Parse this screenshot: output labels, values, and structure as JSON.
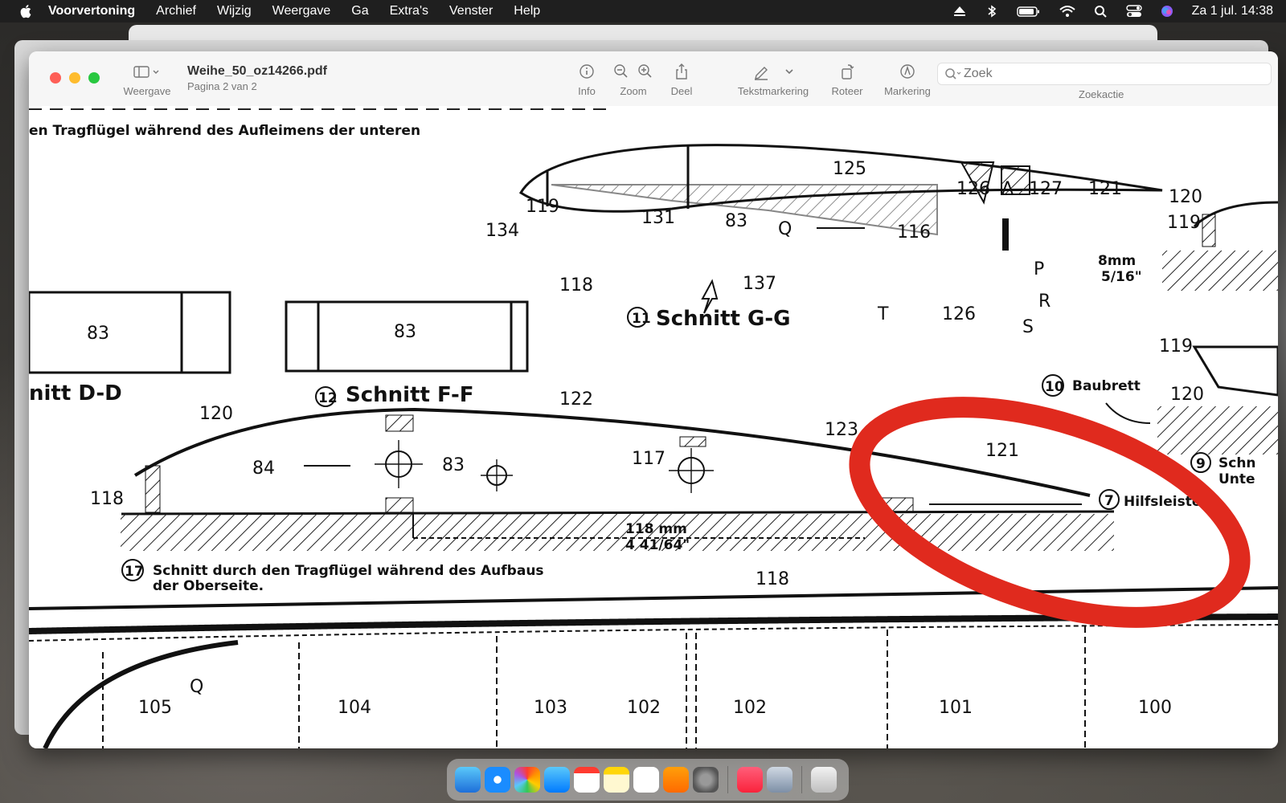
{
  "menubar": {
    "app_name": "Voorvertoning",
    "items": [
      "Archief",
      "Wijzig",
      "Weergave",
      "Ga",
      "Extra's",
      "Venster",
      "Help"
    ],
    "datetime": "Za 1 jul.  14:38"
  },
  "window": {
    "title": "Weihe_50_oz14266.pdf",
    "subtitle": "Pagina 2 van 2",
    "toolbar": {
      "view_label": "Weergave",
      "info_label": "Info",
      "zoom_label": "Zoom",
      "share_label": "Deel",
      "highlight_label": "Tekstmarkering",
      "rotate_label": "Roteer",
      "markup_label": "Markering",
      "search_label": "Zoekactie",
      "search_placeholder": "Zoek"
    }
  },
  "document": {
    "top_text": "en Tragflügel während des Aufleimens der unteren",
    "section_g": "Schnitt  G-G",
    "section_g_num": "11",
    "section_f": "Schnitt  F-F",
    "section_f_num": "12",
    "section_d": "nitt  D-D",
    "baubrett": "Baubrett",
    "baubrett_num": "10",
    "hilfsleiste": "Hilfsleiste",
    "hilfsleiste_num": "7",
    "fig17_num": "17",
    "fig17_line1": "Schnitt durch den Tragflügel während des Aufbaus",
    "fig17_line2": "der Oberseite.",
    "dim_mm": "118 mm",
    "dim_in": "4 41/64\"",
    "dim8_mm": "8mm",
    "dim8_in": "5/16\"",
    "right_cut1": "Schn",
    "right_cut2": "Unte",
    "right_num9": "9",
    "labels": {
      "l125": "125",
      "l126a": "126",
      "lA": "A",
      "l127": "127",
      "l121a": "121",
      "l120a": "120",
      "l119a": "119",
      "l119b": "119",
      "l131": "131",
      "l83a": "83",
      "lQ": "Q",
      "l116": "116",
      "l134": "134",
      "l118a": "118",
      "l137": "137",
      "lP": "P",
      "lR": "R",
      "lS": "S",
      "lT": "T",
      "l126b": "126",
      "l83b": "83",
      "l83c": "83",
      "l119c": "119",
      "l120b": "120",
      "l120c": "120",
      "l122": "122",
      "l123": "123",
      "l84": "84",
      "l83d": "83",
      "l117": "117",
      "l121b": "121",
      "l118b": "118",
      "l118c": "118",
      "lQ2": "Q",
      "l105": "105",
      "l104": "104",
      "l103": "103",
      "l102a": "102",
      "l102b": "102",
      "l101": "101",
      "l100": "100"
    }
  },
  "annotation": {
    "color": "#e02a1e",
    "shape": "ellipse"
  }
}
